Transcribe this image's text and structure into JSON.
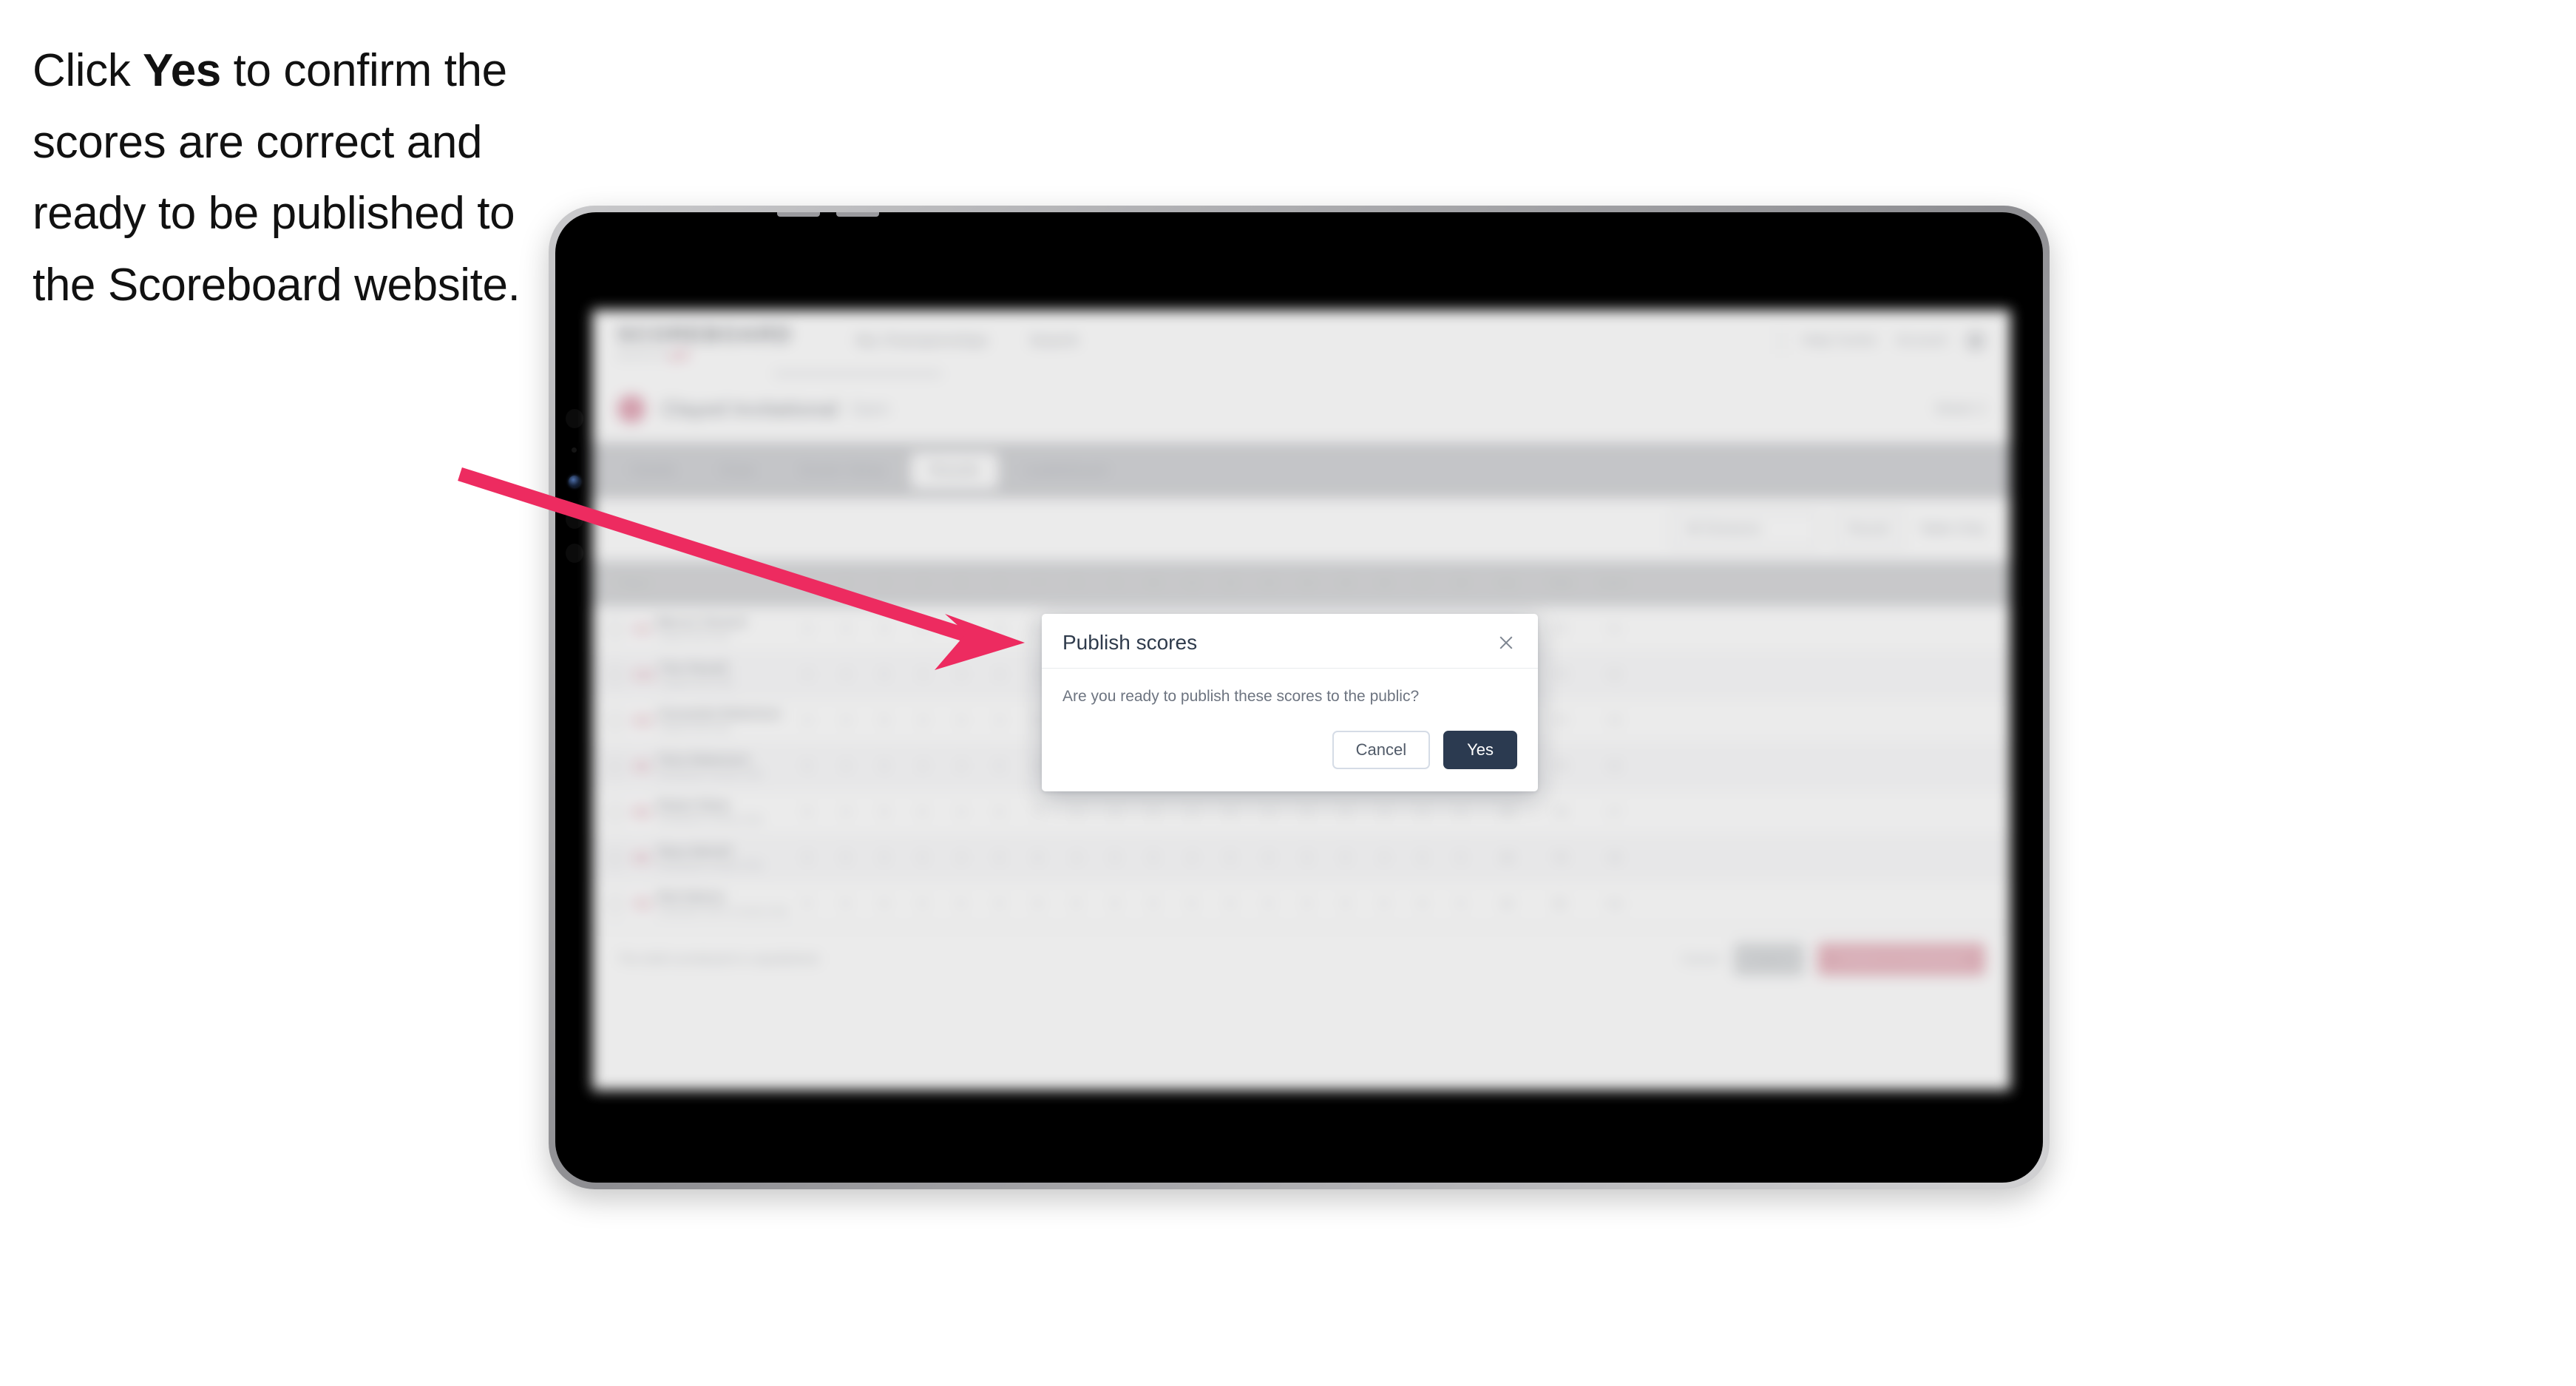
{
  "caption": {
    "before": "Click ",
    "bold": "Yes",
    "after": " to confirm the scores are correct and ready to be published to the Scoreboard website."
  },
  "annotation": {
    "arrow_color": "#ED2B60",
    "arrow_name": "pink-callout-arrow"
  },
  "device": {
    "type": "tablet",
    "bezel_color": "#9a9a9e",
    "screen_bg": "#000000"
  },
  "app": {
    "header": {
      "logo_word": "SCOREBOARD",
      "logo_tagline": "powered by",
      "logo_tagline_accent": "golf",
      "nav": [
        {
          "label": "My Championships"
        },
        {
          "label": "Search"
        }
      ],
      "right_items": [
        {
          "label": "Help Centre"
        },
        {
          "label": "Account"
        }
      ]
    },
    "tournament": {
      "name": "Clayed Invitational",
      "status": "Open",
      "right_meta": "Week 3"
    },
    "tabs": [
      {
        "label": "Details",
        "active": false
      },
      {
        "label": "Draw",
        "active": false
      },
      {
        "label": "Scorer Setup",
        "active": false
      },
      {
        "label": "Results",
        "active": true
      },
      {
        "label": "Leaderboard",
        "active": false
      }
    ],
    "filters": {
      "select_label": "All Divisions",
      "round_label": "Round",
      "view_label": "Table Only"
    },
    "table": {
      "columns": [
        "Player",
        "1",
        "2",
        "3",
        "4",
        "5",
        "6",
        "7",
        "8",
        "9",
        "10",
        "11",
        "12",
        "13",
        "14",
        "15",
        "16",
        "17",
        "18",
        "Out",
        "Total",
        "Score"
      ],
      "rows": [
        {
          "rank": "1st",
          "name": "Marcus Tennent",
          "club": "Clayed Golf Club",
          "holes": [
            "4",
            "3",
            "5",
            "4",
            "3",
            "4",
            "5",
            "4",
            "3",
            "4",
            "4",
            "5",
            "3",
            "4",
            "4",
            "3",
            "5",
            "4"
          ],
          "out": "35",
          "total": "72",
          "score": "+1",
          "par": "-2"
        },
        {
          "rank": "2nd",
          "name": "Finn Parnell",
          "club": "Clayed Golf Club",
          "holes": [
            "4",
            "4",
            "5",
            "3",
            "4",
            "4",
            "5",
            "4",
            "4",
            "4",
            "3",
            "5",
            "4",
            "4",
            "4",
            "4",
            "5",
            "4"
          ],
          "out": "36",
          "total": "73",
          "score": "+2",
          "par": "-1"
        },
        {
          "rank": "3rd",
          "name": "Cassandra Robertson",
          "club": "Clayed Golf Club",
          "holes": [
            "4",
            "4",
            "5",
            "4",
            "4",
            "4",
            "5",
            "4",
            "4",
            "4",
            "4",
            "5",
            "4",
            "4",
            "4",
            "4",
            "5",
            "4"
          ],
          "out": "37",
          "total": "74",
          "score": "+3",
          "par": "E"
        },
        {
          "rank": "4th",
          "name": "Chris Robertson",
          "club": "Northlands Country Club",
          "holes": [
            "5",
            "4",
            "5",
            "4",
            "4",
            "5",
            "5",
            "4",
            "4",
            "5",
            "4",
            "5",
            "4",
            "4",
            "5",
            "4",
            "5",
            "4"
          ],
          "out": "38",
          "total": "76",
          "score": "+5",
          "par": "+1"
        },
        {
          "rank": "5th",
          "name": "Robert Shaw",
          "club": "Northlands Country Club",
          "holes": [
            "5",
            "4",
            "5",
            "5",
            "4",
            "5",
            "5",
            "4",
            "4",
            "5",
            "4",
            "5",
            "4",
            "5",
            "5",
            "4",
            "5",
            "5"
          ],
          "out": "39",
          "total": "78",
          "score": "+7",
          "par": "+2"
        },
        {
          "rank": "6th",
          "name": "Steve Nicholl",
          "club": "Northlands Country Club",
          "holes": [
            "5",
            "5",
            "5",
            "5",
            "4",
            "5",
            "6",
            "4",
            "5",
            "5",
            "4",
            "5",
            "5",
            "5",
            "5",
            "4",
            "5",
            "5"
          ],
          "out": "40",
          "total": "79",
          "score": "+8",
          "par": "+3"
        },
        {
          "rank": "7th",
          "name": "Nick Nelson",
          "club": "Southside Golf & Country Club",
          "holes": [
            "5",
            "5",
            "6",
            "5",
            "5",
            "5",
            "6",
            "5",
            "5",
            "5",
            "5",
            "5",
            "5",
            "5",
            "5",
            "5",
            "6",
            "5"
          ],
          "out": "42",
          "total": "82",
          "score": "+11",
          "par": "+5"
        }
      ]
    },
    "footer": {
      "note": "The draft scoreboard is unpublished.",
      "link_label": "Cancel",
      "secondary_button": "Save",
      "primary_button": "Publish to Scoreboard"
    }
  },
  "modal": {
    "title": "Publish scores",
    "body": "Are you ready to publish these scores to the public?",
    "cancel_label": "Cancel",
    "confirm_label": "Yes",
    "close_icon": "close-icon",
    "confirm_color": "#2b3a50"
  }
}
